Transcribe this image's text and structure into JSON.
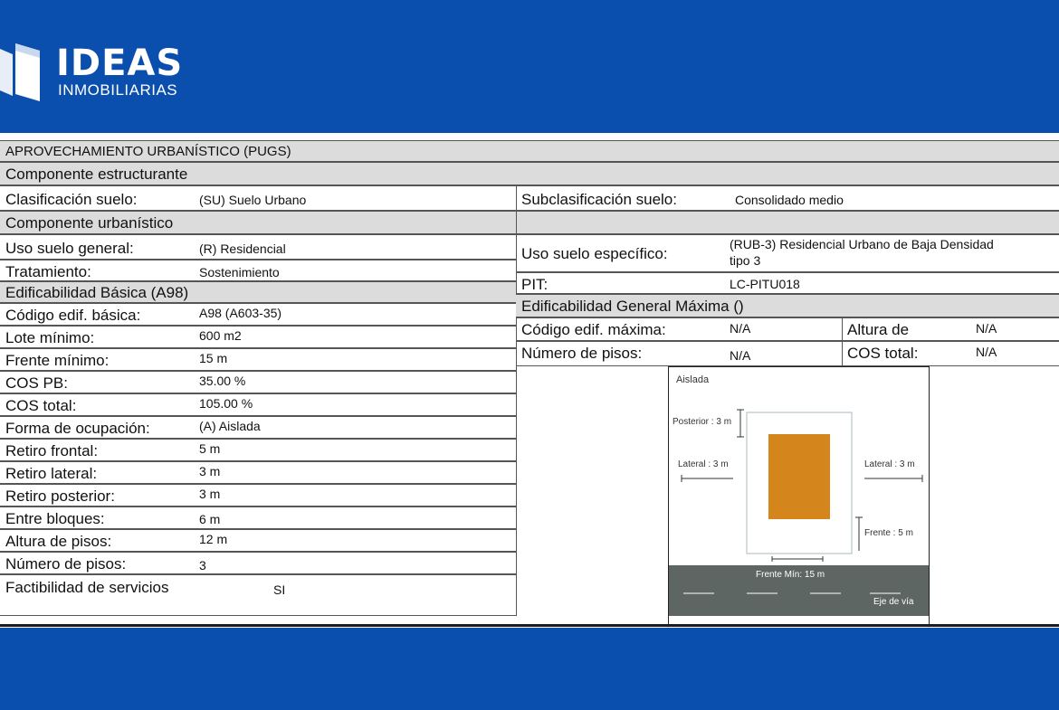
{
  "logo": {
    "title": "IDEAS",
    "subtitle": "INMOBILIARIAS"
  },
  "colors": {
    "background": "#0b4fae",
    "section_gray": "#dcdcdc",
    "building": "#d4861c",
    "road": "#5d6663"
  },
  "header": "APROVECHAMIENTO URBANÍSTICO (PUGS)",
  "estructurante": {
    "title": "Componente  estructurante",
    "clasificacion_label": "Clasificación suelo:",
    "clasificacion_value": "(SU) Suelo Urbano",
    "subclasificacion_label": "Subclasificación suelo:",
    "subclasificacion_value": "Consolidado medio"
  },
  "urbanistico": {
    "title": "Componente  urbanístico",
    "uso_general_label": "Uso suelo general:",
    "uso_general_value": "(R) Residencial",
    "tratamiento_label": "Tratamiento:",
    "tratamiento_value": "Sostenimiento",
    "uso_especifico_label": "Uso suelo específico:",
    "uso_especifico_value_line1": "(RUB-3) Residencial Urbano de Baja Densidad",
    "uso_especifico_value_line2": "tipo 3",
    "pit_label": "PIT:",
    "pit_value": "LC-PITU018"
  },
  "basica": {
    "title": "Edificabilidad Básica (A98)",
    "rows": [
      {
        "label": "Código edif. básica:",
        "value": "A98 (A603-35)"
      },
      {
        "label": "Lote mínimo:",
        "value": "600 m2"
      },
      {
        "label": "Frente mínimo:",
        "value": "15 m"
      },
      {
        "label": "COS PB:",
        "value": "35.00 %"
      },
      {
        "label": "COS total:",
        "value": "105.00 %"
      },
      {
        "label": "Forma de ocupación:",
        "value": "(A) Aislada"
      },
      {
        "label": "Retiro frontal:",
        "value": "5 m"
      },
      {
        "label": "Retiro lateral:",
        "value": "3 m"
      },
      {
        "label": "Retiro posterior:",
        "value": "3 m"
      },
      {
        "label": "Entre bloques:",
        "value": "6 m"
      },
      {
        "label": "Altura de pisos:",
        "value": "12 m"
      },
      {
        "label": "Número de pisos:",
        "value": "3"
      }
    ],
    "factibilidad_label": "Factibilidad de servicios",
    "factibilidad_value": "SI"
  },
  "maxima": {
    "title": "Edificabilidad General Máxima ()",
    "codigo_label": "Código edif. máxima:",
    "codigo_value": "N/A",
    "altura_label": "Altura de",
    "altura_value": "N/A",
    "pisos_label": "Número de pisos:",
    "pisos_value": "N/A",
    "cos_label": "COS total:",
    "cos_value": "N/A"
  },
  "diagram": {
    "aislada": "Aislada",
    "posterior": "Posterior : 3 m",
    "lateral_left": "Lateral : 3 m",
    "lateral_right": "Lateral : 3 m",
    "frente": "Frente : 5 m",
    "frente_min": "Frente Mín: 15 m",
    "eje": "Eje de vía"
  }
}
